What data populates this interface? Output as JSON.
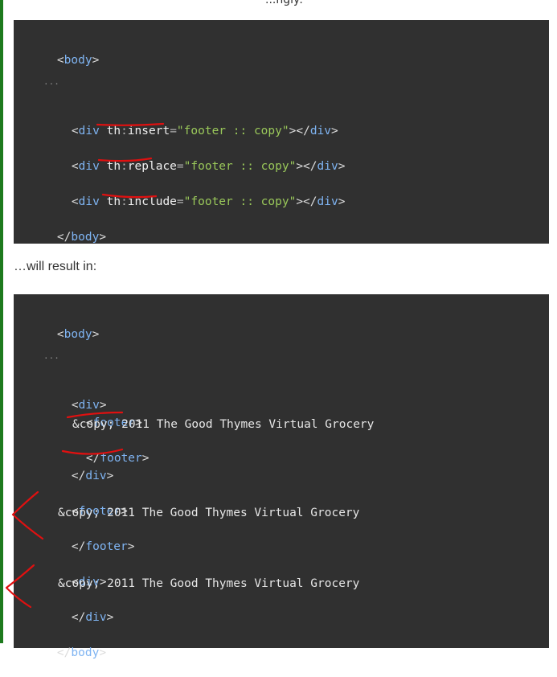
{
  "top_fragment": "...ngly:",
  "block1": {
    "body_open": "body",
    "ellipsis": "...",
    "rows": [
      {
        "kw": "insert",
        "val": "footer :: copy"
      },
      {
        "kw": "replace",
        "val": "footer :: copy"
      },
      {
        "kw": "include",
        "val": "footer :: copy"
      }
    ],
    "div": "div",
    "th": "th",
    "body_close": "body"
  },
  "prose": "…will result in:",
  "block2": {
    "body_open": "body",
    "ellipsis": "...",
    "div": "div",
    "footer": "footer",
    "copy_text": "&copy; 2011 The Good Thymes Virtual Grocery",
    "body_close": "body"
  },
  "colors": {
    "code_bg": "#303030",
    "tag": "#7fb4f2",
    "string": "#9ac85a",
    "annotation": "#e01010",
    "sidebar": "#1d7a1d"
  }
}
